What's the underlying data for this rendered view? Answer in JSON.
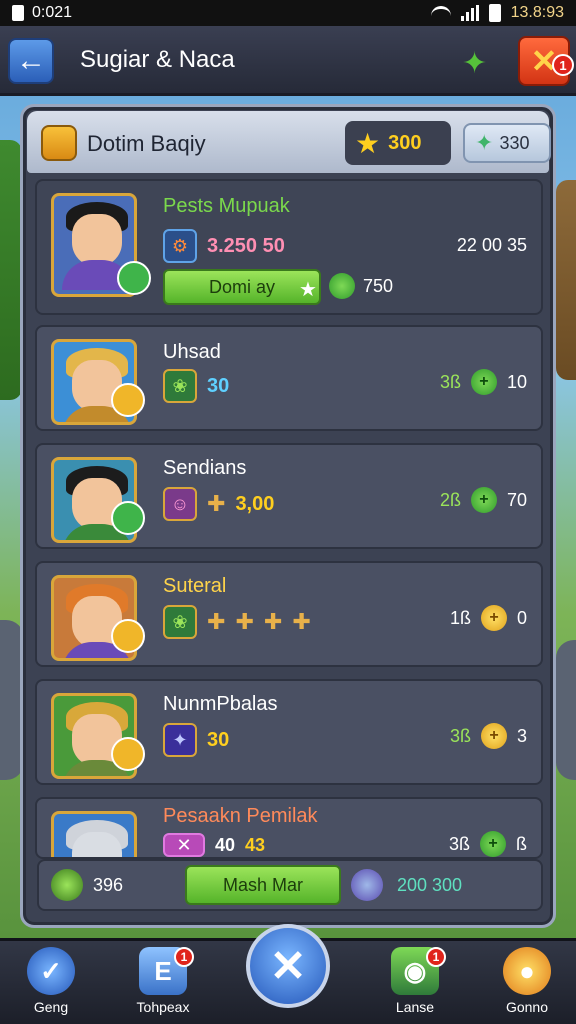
{
  "status_bar": {
    "time": "0:021",
    "right_time": "13.8:93"
  },
  "header": {
    "title": "Sugiar & Naca",
    "close_badge": "1"
  },
  "panel": {
    "title": "Dotim Baqiy",
    "star_value": "300",
    "gem_value": "330"
  },
  "rows": [
    {
      "name": "Pests Mupuak",
      "name_color": "#7bd94c",
      "sub_value": "3.250 50",
      "sub_color": "#ff8fb3",
      "right_text": "22  00  35",
      "deploy_label": "Domi ay",
      "deploy_extra": "750"
    },
    {
      "name": "Uhsad",
      "name_color": "#ffffff",
      "sub_value": "30",
      "sub_color": "#5fd0ff",
      "right_a": "3ß",
      "right_b": "10"
    },
    {
      "name": "Sendians",
      "name_color": "#ffffff",
      "sub_value": "3,00",
      "sub_color": "#ffcf1f",
      "right_a": "2ß",
      "right_b": "70"
    },
    {
      "name": "Suteral",
      "name_color": "#ffd44a",
      "sub_value": "",
      "sub_color": "#ffcf1f",
      "right_a": "1ß",
      "right_b": "0"
    },
    {
      "name": "NunmPbalas",
      "name_color": "#ffffff",
      "sub_value": "30",
      "sub_color": "#ffcf1f",
      "right_a": "3ß",
      "right_b": "3"
    },
    {
      "name": "Pesaakn Pemilak",
      "name_color": "#ff8a5a",
      "sub_value": "40",
      "sub_value2": "43",
      "sub_color": "#ffffff",
      "right_a": "3ß",
      "right_b": "ß"
    }
  ],
  "footer": {
    "left_value": "396",
    "button_label": "Mash Mar",
    "right_value": "200 300"
  },
  "nav": [
    {
      "label": "Geng"
    },
    {
      "label": "Tohpeax",
      "badge": "1"
    },
    {
      "label": "Lanse",
      "badge": "1"
    },
    {
      "label": "Gonno"
    }
  ]
}
